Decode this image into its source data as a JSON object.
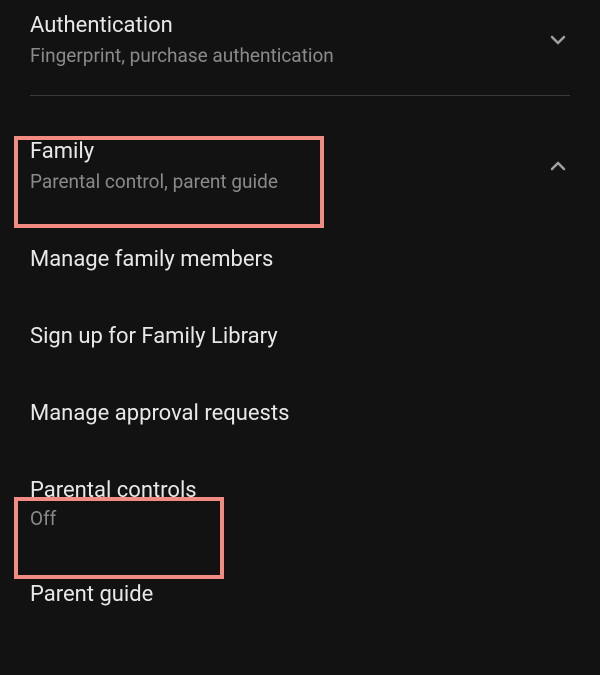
{
  "sections": {
    "authentication": {
      "title": "Authentication",
      "subtitle": "Fingerprint, purchase authentication",
      "expanded": false
    },
    "family": {
      "title": "Family",
      "subtitle": "Parental control, parent guide",
      "expanded": true,
      "items": [
        {
          "label": "Manage family members"
        },
        {
          "label": "Sign up for Family Library"
        },
        {
          "label": "Manage approval requests"
        },
        {
          "label": "Parental controls",
          "status": "Off"
        },
        {
          "label": "Parent guide"
        }
      ]
    }
  }
}
